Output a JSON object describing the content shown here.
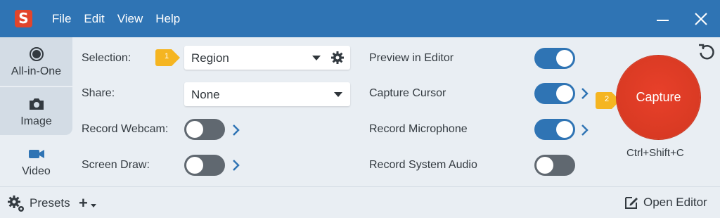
{
  "titlebar": {
    "logo_letter": "S",
    "menu": [
      "File",
      "Edit",
      "View",
      "Help"
    ]
  },
  "sidebar": {
    "modes": [
      {
        "label": "All-in-One",
        "icon": "record-circle-icon",
        "state": "inactive"
      },
      {
        "label": "Image",
        "icon": "camera-icon",
        "state": "inactive"
      },
      {
        "label": "Video",
        "icon": "video-camera-icon",
        "state": "active"
      }
    ]
  },
  "settings": {
    "selection_label": "Selection:",
    "selection_value": "Region",
    "share_label": "Share:",
    "share_value": "None",
    "webcam_label": "Record Webcam:",
    "screendraw_label": "Screen Draw:",
    "preview_label": "Preview in Editor",
    "cursor_label": "Capture Cursor",
    "microphone_label": "Record Microphone",
    "sysaudio_label": "Record System Audio"
  },
  "toggles": {
    "webcam": false,
    "screen_draw": false,
    "preview_in_editor": true,
    "capture_cursor": true,
    "record_microphone": true,
    "record_system_audio": false
  },
  "callouts": {
    "first": "1",
    "second": "2"
  },
  "capture": {
    "label": "Capture",
    "shortcut": "Ctrl+Shift+C"
  },
  "bottom": {
    "presets_label": "Presets",
    "add_symbol": "+",
    "open_editor_label": "Open Editor"
  },
  "colors": {
    "titlebar": "#2f74b4",
    "accent": "#2f74b4",
    "capture": "#e0391f",
    "callout": "#f5b521",
    "toggle_off": "#606870"
  }
}
